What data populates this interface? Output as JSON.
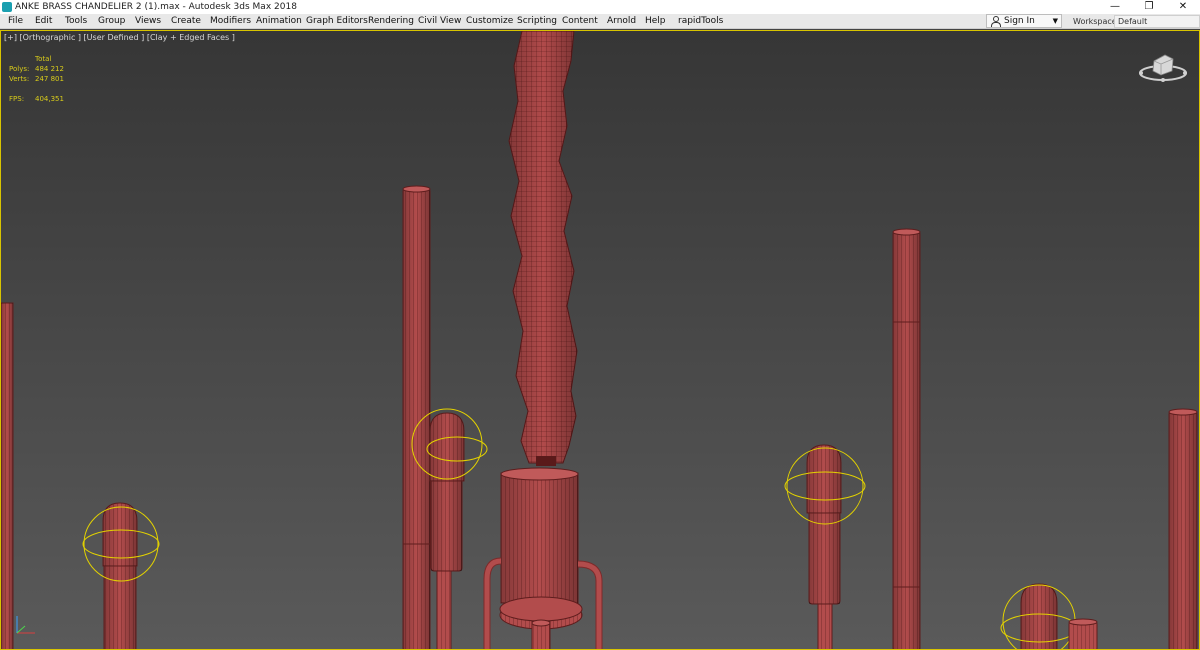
{
  "window": {
    "title": "ANKE BRASS CHANDELIER 2 (1).max - Autodesk 3ds Max 2018",
    "controls": [
      "—",
      "❐",
      "✕"
    ]
  },
  "menubar": {
    "items": [
      "File",
      "Edit",
      "Tools",
      "Group",
      "Views",
      "Create",
      "Modifiers",
      "Animation",
      "Graph Editors",
      "Rendering",
      "Civil View",
      "Customize",
      "Scripting",
      "Content",
      "Arnold",
      "Help",
      "rapidTools"
    ],
    "sign_in": "Sign In",
    "workspaces_label": "Workspaces:",
    "workspace_value": "Default"
  },
  "viewport": {
    "label": "[+] [Orthographic ] [User Defined ] [Clay + Edged Faces ]",
    "stats": {
      "header": "Total",
      "polys_label": "Polys:",
      "polys_value": "484 212",
      "verts_label": "Verts:",
      "verts_value": "247 801",
      "fps_label": "FPS:",
      "fps_value": "404,351"
    },
    "colors": {
      "mesh": "#b04a4a",
      "wire": "#5e1d1d",
      "selection": "#e3d200"
    }
  }
}
